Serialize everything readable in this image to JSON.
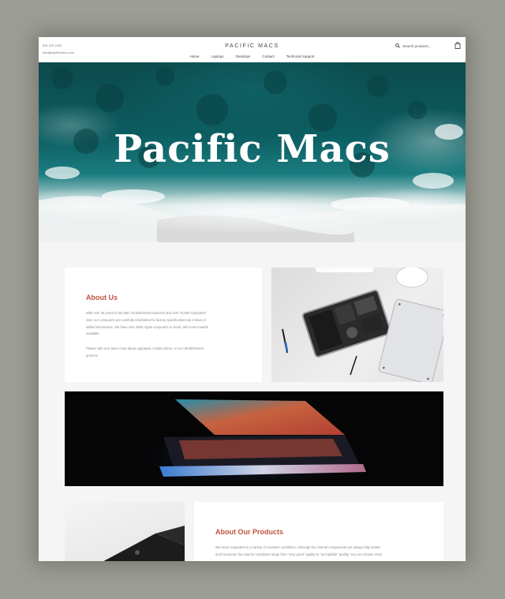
{
  "header": {
    "phone": "831 226 2434",
    "email": "info@pacificmacs.com",
    "brand": "PACIFIC MACS",
    "nav": [
      "Home",
      "Laptops",
      "Desktops",
      "Contact",
      "Technical Support"
    ],
    "search_placeholder": "Search products..."
  },
  "hero": {
    "title": "Pacific Macs"
  },
  "about": {
    "title": "About Us",
    "p1_lines": [
      "With over 25 years in the Mac refurbishment business and over 70,000 computers",
      "sold, our computers are carefully refurbished to factory specifications by a team of",
      "skilled technicians. We have over 3000 Apple computers in stock, with most models",
      "available."
    ],
    "p2_lines": [
      "Please call us to learn more about upgrades, custom items, or our refurbishment",
      "process."
    ]
  },
  "products": {
    "title": "About Our Products",
    "lines": [
      "We stock computers in a variety of cosmetic conditions. Although the internal components are always fully tested",
      "and functional, the exterior conditions range from \"very good\" quality to \"acceptable\" quality. You can choose most"
    ]
  },
  "colors": {
    "accent": "#c0533f",
    "page_bg": "#f5f5f5"
  }
}
